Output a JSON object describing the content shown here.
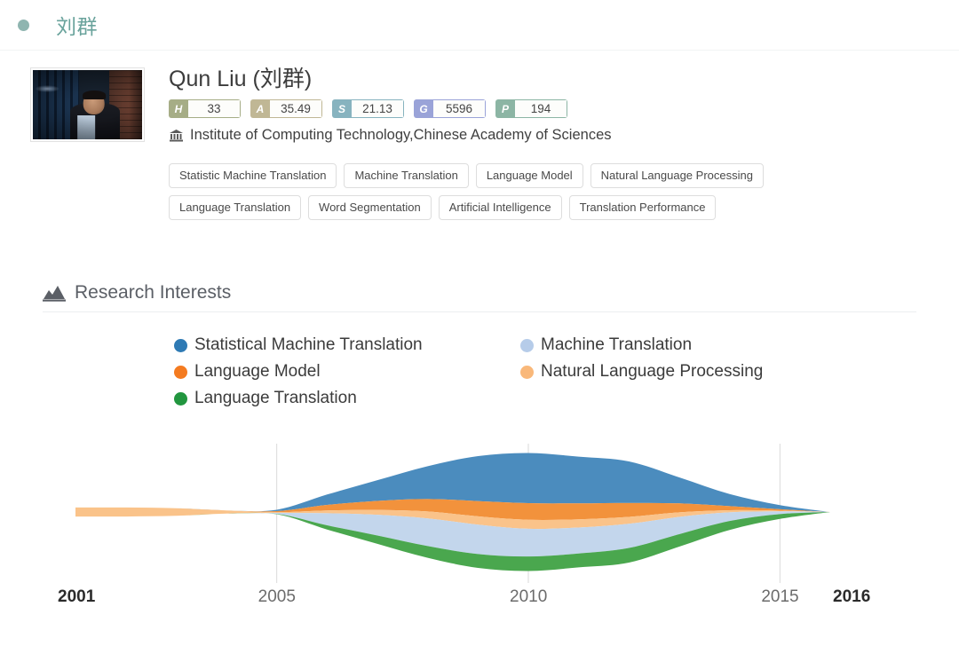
{
  "header": {
    "bullet_icon": "dot-icon",
    "title": "刘群",
    "accent_color": "#6aa39c"
  },
  "profile": {
    "avatar_alt": "portrait-photo",
    "name": "Qun Liu (刘群)",
    "badges": [
      {
        "key": "H",
        "key_icon": "h-index-icon",
        "value": "33",
        "color": "#a6ad86"
      },
      {
        "key": "A",
        "key_icon": "a-index-icon",
        "value": "35.49",
        "color": "#c0b795"
      },
      {
        "key": "S",
        "key_icon": "s-index-icon",
        "value": "21.13",
        "color": "#87b3bf"
      },
      {
        "key": "G",
        "key_icon": "g-index-icon",
        "value": "5596",
        "color": "#9aa3d8"
      },
      {
        "key": "P",
        "key_icon": "p-index-icon",
        "value": "194",
        "color": "#8cb5a4"
      }
    ],
    "affiliation_icon": "institution-icon",
    "affiliation": "Institute of Computing Technology,Chinese Academy of Sciences",
    "tags": [
      "Statistic Machine Translation",
      "Machine Translation",
      "Language Model",
      "Natural Language Processing",
      "Language Translation",
      "Word Segmentation",
      "Artificial Intelligence",
      "Translation Performance"
    ]
  },
  "section": {
    "icon": "area-chart-icon",
    "title": "Research Interests"
  },
  "chart_data": {
    "type": "area",
    "title": "Research Interests",
    "xlabel": "",
    "ylabel": "",
    "xlim": [
      2001,
      2016
    ],
    "grid": true,
    "grid_years": [
      2005,
      2010,
      2015
    ],
    "tick_labels": [
      "2001",
      "2005",
      "2010",
      "2015",
      "2016"
    ],
    "endpoint_labels": [
      "2001",
      "2016"
    ],
    "legend_position": "top",
    "stack_order_top_to_bottom": [
      "Statistical Machine Translation",
      "Language Model",
      "Natural Language Processing",
      "Machine Translation",
      "Language Translation"
    ],
    "x": [
      2001,
      2002,
      2003,
      2004,
      2005,
      2006,
      2007,
      2008,
      2009,
      2010,
      2011,
      2012,
      2013,
      2014,
      2015,
      2016
    ],
    "series": [
      {
        "name": "Statistical Machine Translation",
        "color": "#4b8cbe",
        "values": [
          0,
          0,
          0,
          0,
          0.4,
          3.0,
          6.0,
          9.5,
          13.0,
          14.5,
          13.5,
          12.0,
          7.5,
          3.5,
          1.2,
          0
        ]
      },
      {
        "name": "Machine Translation",
        "color": "#c3d6ec",
        "values": [
          0,
          0,
          0,
          0,
          0.3,
          3.5,
          6.0,
          8.0,
          8.5,
          8.0,
          7.5,
          7.0,
          5.0,
          2.5,
          0.8,
          0
        ]
      },
      {
        "name": "Language Model",
        "color": "#f2923c",
        "values": [
          0,
          0,
          0,
          0,
          0.3,
          1.6,
          2.6,
          3.6,
          4.4,
          4.8,
          4.6,
          4.0,
          2.6,
          1.2,
          0.4,
          0
        ]
      },
      {
        "name": "Natural Language Processing",
        "color": "#fac38a",
        "values": [
          2.6,
          2.6,
          2.2,
          0.9,
          0.2,
          0.8,
          1.4,
          2.0,
          2.4,
          2.6,
          2.4,
          2.0,
          1.3,
          0.6,
          0.2,
          0
        ]
      },
      {
        "name": "Language Translation",
        "color": "#4aa74e",
        "values": [
          0,
          0,
          0,
          0,
          0.1,
          1.2,
          2.4,
          3.4,
          4.0,
          4.2,
          4.0,
          4.2,
          3.6,
          2.6,
          1.4,
          0
        ]
      }
    ],
    "legend": [
      {
        "label": "Statistical Machine Translation",
        "color": "#2e7ab4"
      },
      {
        "label": "Machine Translation",
        "color": "#b6cce9"
      },
      {
        "label": "Language Model",
        "color": "#f47b20"
      },
      {
        "label": "Natural Language Processing",
        "color": "#f9b87a"
      },
      {
        "label": "Language Translation",
        "color": "#22963f"
      }
    ]
  }
}
